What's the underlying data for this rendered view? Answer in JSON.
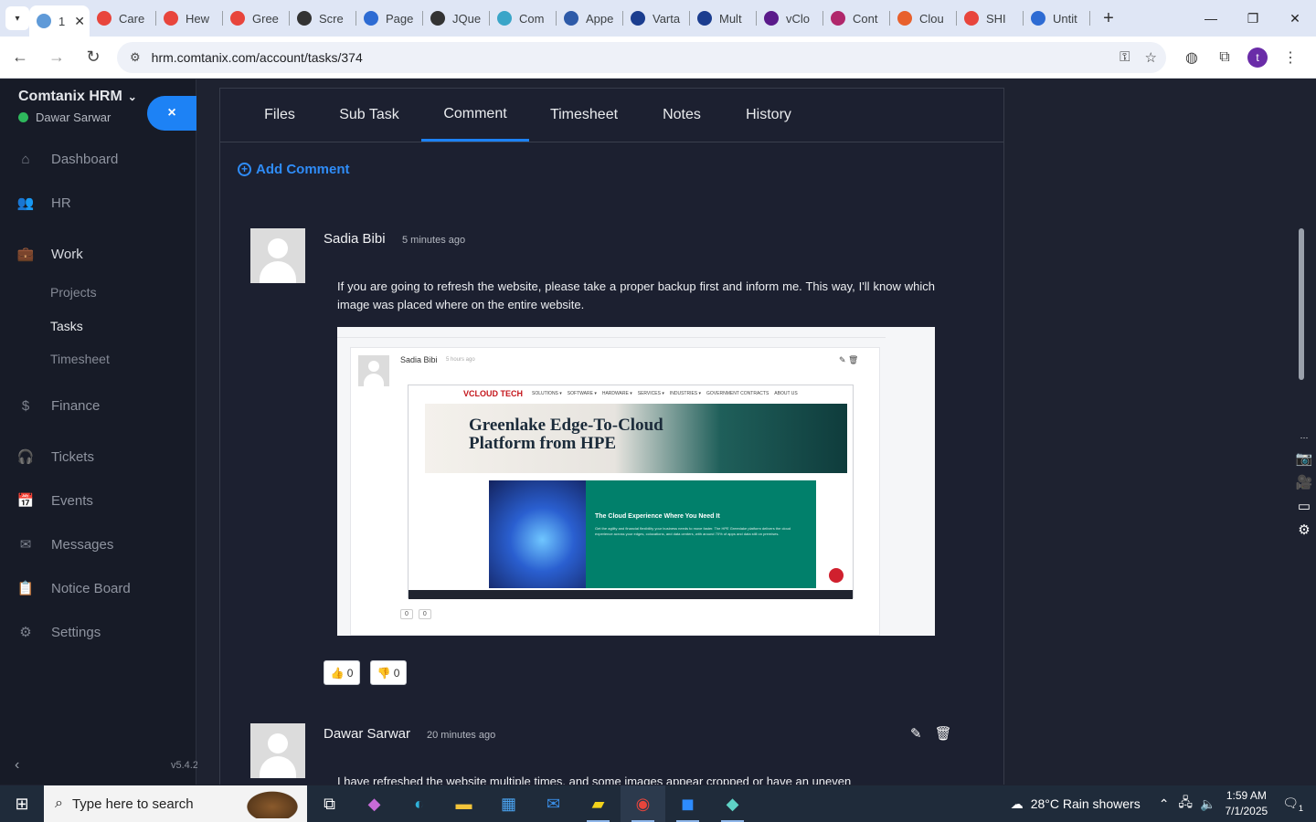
{
  "browser": {
    "tabs": [
      {
        "label": "1",
        "fav": "#5f9ad8",
        "active": true
      },
      {
        "label": "Care",
        "fav": "#e8453c"
      },
      {
        "label": "Hew",
        "fav": "#e8453c"
      },
      {
        "label": "Gree",
        "fav": "#e8453c"
      },
      {
        "label": "Scre",
        "fav": "#333333"
      },
      {
        "label": "Page",
        "fav": "#2d6bd3"
      },
      {
        "label": "JQue",
        "fav": "#333333"
      },
      {
        "label": "Com",
        "fav": "#3aa5c8"
      },
      {
        "label": "Appe",
        "fav": "#2d5aa8"
      },
      {
        "label": "Varta",
        "fav": "#1b3d8f"
      },
      {
        "label": "Mult",
        "fav": "#1b3d8f"
      },
      {
        "label": "vClo",
        "fav": "#5a1a8a"
      },
      {
        "label": "Cont",
        "fav": "#b0276b"
      },
      {
        "label": "Clou",
        "fav": "#e8602c"
      },
      {
        "label": "SHI",
        "fav": "#e8453c"
      },
      {
        "label": "Untit",
        "fav": "#2d6bd3"
      }
    ],
    "url": "hrm.comtanix.com/account/tasks/374",
    "profile_initial": "t"
  },
  "sidebar": {
    "company": "Comtanix HRM",
    "user": "Dawar Sarwar",
    "close_label": "×",
    "menu": [
      {
        "label": "Dashboard",
        "icon": "⌂"
      },
      {
        "label": "HR",
        "icon": "👥"
      },
      {
        "label": "Work",
        "icon": "💼"
      },
      {
        "label": "Finance",
        "icon": "$"
      },
      {
        "label": "Tickets",
        "icon": "🎧"
      },
      {
        "label": "Events",
        "icon": "📅"
      },
      {
        "label": "Messages",
        "icon": "✉"
      },
      {
        "label": "Notice Board",
        "icon": "📋"
      },
      {
        "label": "Settings",
        "icon": "⚙"
      }
    ],
    "work_submenu": [
      "Projects",
      "Tasks",
      "Timesheet"
    ],
    "version": "v5.4.2"
  },
  "task": {
    "tabs": [
      "Files",
      "Sub Task",
      "Comment",
      "Timesheet",
      "Notes",
      "History"
    ],
    "active_tab": "Comment",
    "add_comment": "Add Comment",
    "comments": [
      {
        "name": "Sadia Bibi",
        "time": "5 minutes ago",
        "text": "If you are going to refresh the website, please take a proper backup first and inform me. This way, I'll know which image was placed where on the entire website.",
        "likes": "0",
        "dislikes": "0"
      },
      {
        "name": "Dawar Sarwar",
        "time": "20 minutes ago",
        "text": "I have refreshed the website multiple times, and some images appear cropped or have an uneven"
      }
    ],
    "attachment": {
      "name": "Sadia Bibi",
      "time": "5 hours ago",
      "brand": "VCLOUD TECH",
      "nav": [
        "SOLUTIONS ▾",
        "SOFTWARE ▾",
        "HARDWARE ▾",
        "SERVICES ▾",
        "INDUSTRIES ▾",
        "GOVERNMENT CONTRACTS",
        "ABOUT US"
      ],
      "hero_line1": "Greenlake Edge-To-Cloud",
      "hero_line2": "Platform from HPE",
      "card_title": "The Cloud Experience Where You Need It",
      "card_text": "Get the agility and financial flexibility your business needs to move faster. The HPE Greenlake platform delivers the cloud experience across your edges, colocations, and data centers, with around 70% of apps and data still on premises.",
      "mini_likes": "0",
      "mini_dislikes": "0"
    }
  },
  "taskbar": {
    "search_placeholder": "Type here to search",
    "weather": "28°C  Rain showers",
    "time": "1:59 AM",
    "date": "7/1/2025",
    "notifications": "1"
  }
}
